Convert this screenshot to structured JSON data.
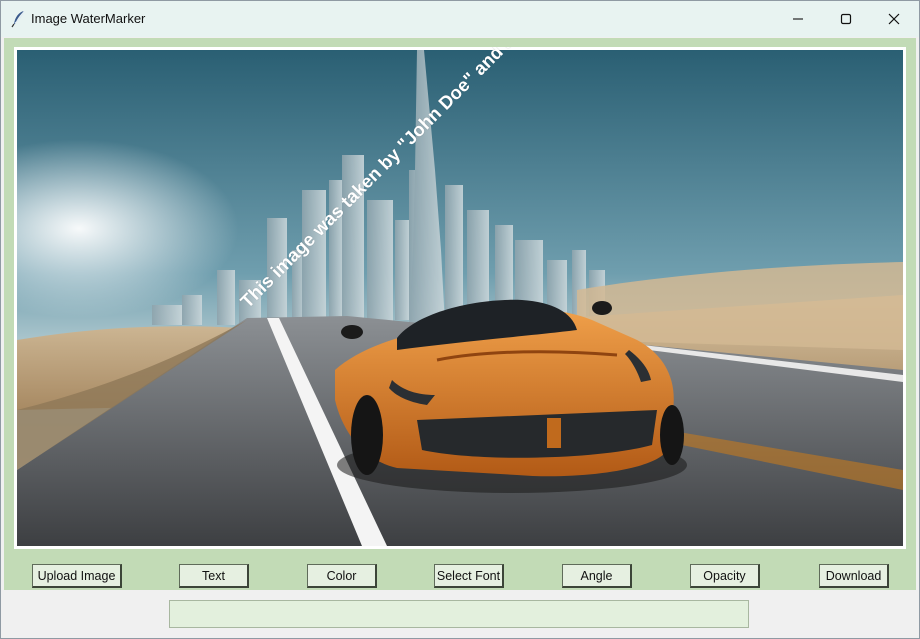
{
  "window": {
    "title": "Image WaterMarker",
    "icons": {
      "app": "feather-icon",
      "minimize": "minimize-icon",
      "maximize": "maximize-icon",
      "close": "close-icon"
    }
  },
  "canvas": {
    "watermark_text": "This image was taken by \"John Doe\" and all rights are reserved.",
    "watermark_color": "#ffffff",
    "watermark_angle_deg": 45
  },
  "toolbar": {
    "upload_label": "Upload Image",
    "text_label": "Text",
    "color_label": "Color",
    "font_label": "Select Font",
    "angle_label": "Angle",
    "opacity_label": "Opacity",
    "download_label": "Download"
  },
  "status": {
    "value": ""
  },
  "colors": {
    "panel_bg": "#c2dbb6",
    "button_bg": "#e6f0e1",
    "field_bg": "#e3f0dd"
  }
}
